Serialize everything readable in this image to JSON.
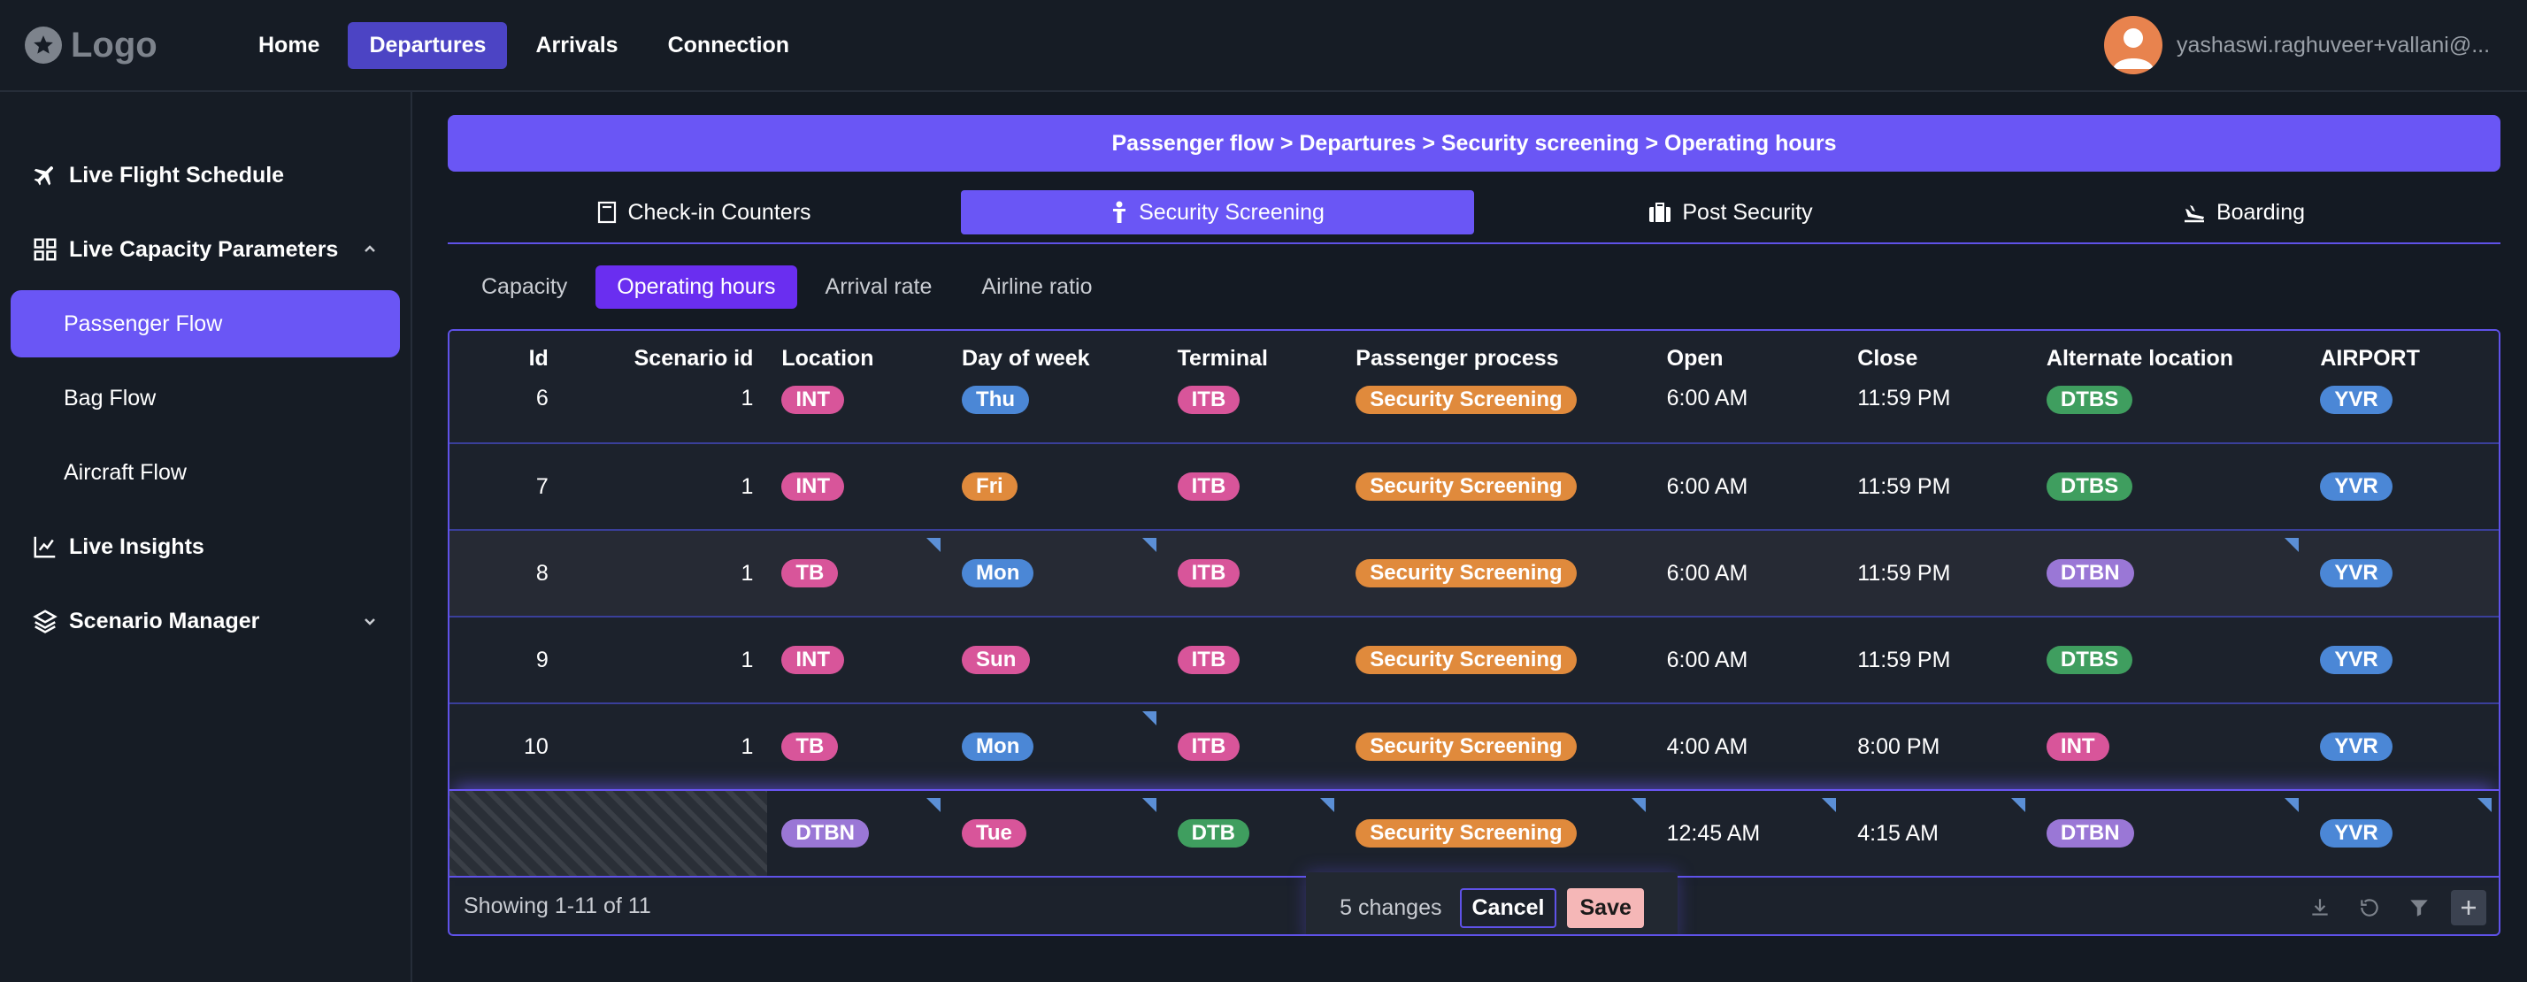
{
  "header": {
    "logo_text": "Logo",
    "nav": [
      {
        "label": "Home",
        "active": false
      },
      {
        "label": "Departures",
        "active": true
      },
      {
        "label": "Arrivals",
        "active": false
      },
      {
        "label": "Connection",
        "active": false
      }
    ],
    "user_name": "yashaswi.raghuveer+vallani@..."
  },
  "sidebar": {
    "items": [
      {
        "label": "Live Flight Schedule",
        "icon": "plane-icon"
      },
      {
        "label": "Live Capacity Parameters",
        "icon": "dashboard-grid-icon",
        "expanded": true
      },
      {
        "label": "Passenger Flow",
        "sub": true,
        "active": true
      },
      {
        "label": "Bag Flow",
        "sub": true
      },
      {
        "label": "Aircraft Flow",
        "sub": true
      },
      {
        "label": "Live Insights",
        "icon": "line-chart-icon"
      },
      {
        "label": "Scenario Manager",
        "icon": "layers-icon",
        "expanded": false
      }
    ]
  },
  "breadcrumb": "Passenger flow > Departures > Security screening > Operating hours",
  "process_tabs": [
    {
      "label": "Check-in Counters",
      "icon": "counter-icon",
      "active": false
    },
    {
      "label": "Security Screening",
      "icon": "person-icon",
      "active": true
    },
    {
      "label": "Post Security",
      "icon": "luggage-icon",
      "active": false
    },
    {
      "label": "Boarding",
      "icon": "boarding-icon",
      "active": false
    }
  ],
  "sub_tabs": [
    {
      "label": "Capacity",
      "active": false
    },
    {
      "label": "Operating hours",
      "active": true
    },
    {
      "label": "Arrival rate",
      "active": false
    },
    {
      "label": "Airline ratio",
      "active": false
    }
  ],
  "table": {
    "columns": [
      "Id",
      "Scenario id",
      "Location",
      "Day of week",
      "Terminal",
      "Passenger process",
      "Open",
      "Close",
      "Alternate location",
      "AIRPORT"
    ],
    "rows": [
      {
        "id": "6",
        "scenario": "1",
        "location": "INT",
        "day": "Thu",
        "terminal": "ITB",
        "process": "Security Screening",
        "open": "6:00 AM",
        "close": "11:59 PM",
        "alt": "DTBS",
        "airport": "YVR"
      },
      {
        "id": "7",
        "scenario": "1",
        "location": "INT",
        "day": "Fri",
        "terminal": "ITB",
        "process": "Security Screening",
        "open": "6:00 AM",
        "close": "11:59 PM",
        "alt": "DTBS",
        "airport": "YVR"
      },
      {
        "id": "8",
        "scenario": "1",
        "location": "TB",
        "day": "Mon",
        "terminal": "ITB",
        "process": "Security Screening",
        "open": "6:00 AM",
        "close": "11:59 PM",
        "alt": "DTBN",
        "airport": "YVR"
      },
      {
        "id": "9",
        "scenario": "1",
        "location": "INT",
        "day": "Sun",
        "terminal": "ITB",
        "process": "Security Screening",
        "open": "6:00 AM",
        "close": "11:59 PM",
        "alt": "DTBS",
        "airport": "YVR"
      },
      {
        "id": "10",
        "scenario": "1",
        "location": "TB",
        "day": "Mon",
        "terminal": "ITB",
        "process": "Security Screening",
        "open": "4:00 AM",
        "close": "8:00 PM",
        "alt": "INT",
        "airport": "YVR"
      },
      {
        "id": "",
        "scenario": "",
        "location": "DTBN",
        "day": "Tue",
        "terminal": "DTB",
        "process": "Security Screening",
        "open": "12:45 AM",
        "close": "4:15 AM",
        "alt": "DTBN",
        "airport": "YVR"
      }
    ],
    "footer": {
      "showing": "Showing 1-11 of 11",
      "changes": "5 changes",
      "cancel_label": "Cancel",
      "save_label": "Save"
    }
  },
  "pill_colors": {
    "INT": "#d8559a",
    "TB": "#d8559a",
    "DTBN": "#9a77d6",
    "DTBS": "#3f9e5f",
    "DTB": "#3f9e5f",
    "ITB": "#d8559a",
    "YVR": "#4b87d6",
    "Thu": "#4b87d6",
    "Fri": "#e08a3c",
    "Mon": "#4b87d6",
    "Sun": "#d8559a",
    "Tue": "#d8559a",
    "Security Screening": "#e08a3c"
  }
}
